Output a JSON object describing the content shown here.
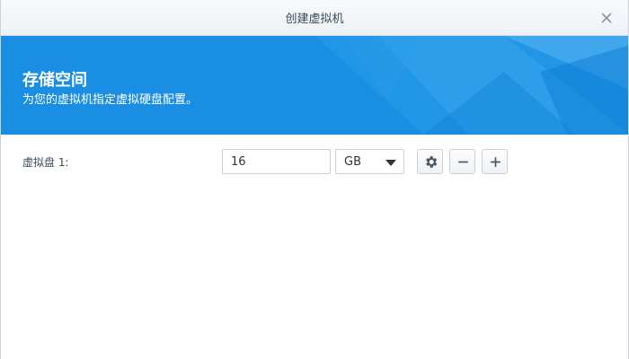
{
  "window": {
    "title": "创建虚拟机",
    "close_icon": "close-icon"
  },
  "banner": {
    "title": "存储空间",
    "subtitle": "为您的虚拟机指定虚拟硬盘配置。",
    "background_color": "#1a8ee2"
  },
  "disk": {
    "label": "虚拟盘 1:",
    "size_value": "16",
    "unit": "GB",
    "buttons": {
      "settings_icon": "gear-icon",
      "remove_icon": "minus-icon",
      "add_icon": "plus-icon"
    }
  }
}
